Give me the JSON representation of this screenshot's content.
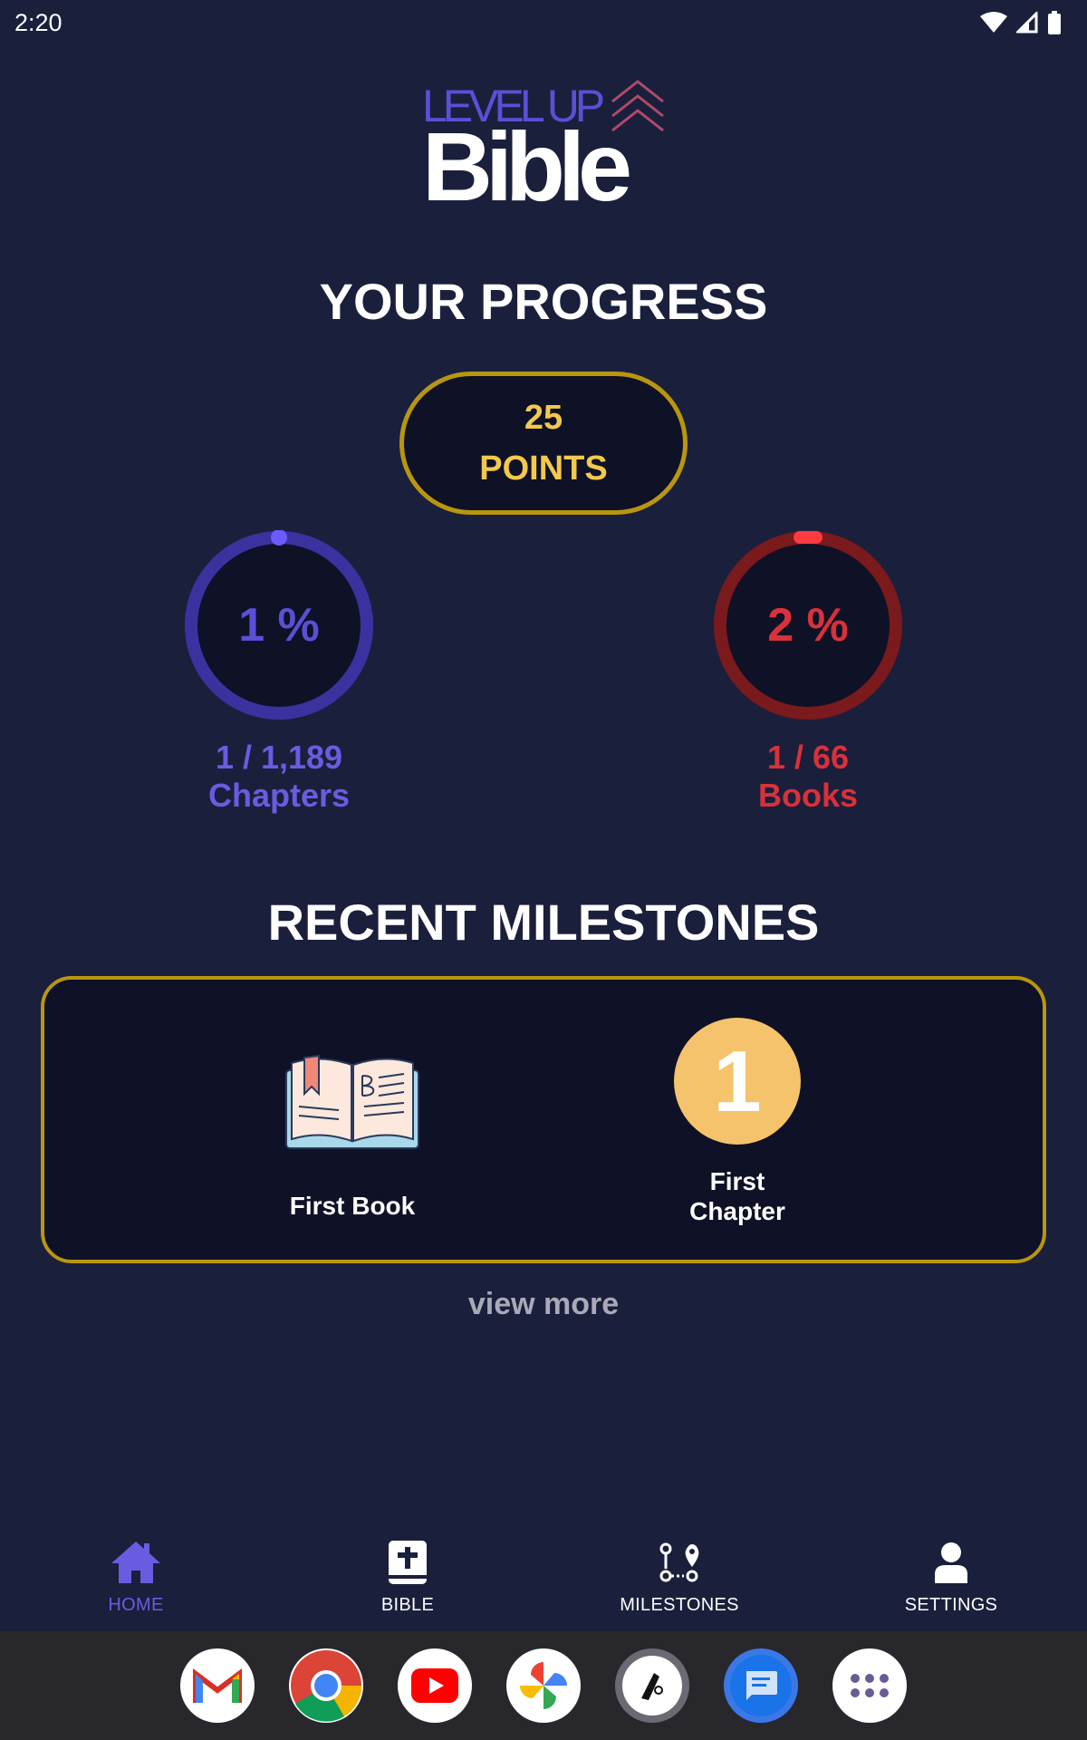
{
  "status_bar": {
    "time": "2:20"
  },
  "logo": {
    "top_text": "LEVEL UP",
    "main_text": "Bible"
  },
  "progress": {
    "title": "YOUR PROGRESS",
    "points_value": "25",
    "points_label": "POINTS",
    "chapters": {
      "percent_text": "1 %",
      "percent": 1,
      "count": "1 / 1,189",
      "label": "Chapters",
      "color": "#5b4fd6"
    },
    "books": {
      "percent_text": "2 %",
      "percent": 2,
      "count": "1 / 66",
      "label": "Books",
      "color": "#d9313a"
    }
  },
  "milestones": {
    "title": "RECENT MILESTONES",
    "items": [
      {
        "label": "First Book",
        "icon": "open-book-icon"
      },
      {
        "label": "First Chapter",
        "icon": "number-one-badge-icon",
        "badge_text": "1"
      }
    ],
    "view_more": "view more"
  },
  "bottom_nav": [
    {
      "label": "HOME",
      "icon": "home-icon",
      "active": true
    },
    {
      "label": "BIBLE",
      "icon": "bible-icon",
      "active": false
    },
    {
      "label": "MILESTONES",
      "icon": "route-icon",
      "active": false
    },
    {
      "label": "SETTINGS",
      "icon": "person-icon",
      "active": false
    }
  ],
  "dock": [
    "gmail-icon",
    "chrome-icon",
    "youtube-icon",
    "photos-icon",
    "app-icon",
    "messages-icon",
    "app-drawer-icon"
  ],
  "colors": {
    "background": "#1a1f3c",
    "gold": "#b8960f",
    "points_text": "#f2c94c",
    "accent_purple": "#5b4fd6",
    "accent_red": "#d9313a"
  }
}
